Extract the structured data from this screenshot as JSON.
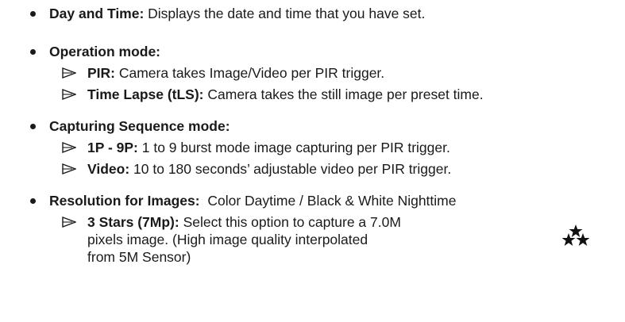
{
  "items": [
    {
      "label": "Day and Time:",
      "text": " Displays the date and time that you have set."
    },
    {
      "label": "Operation mode:",
      "subitems": [
        {
          "label": "PIR:",
          "text": " Camera takes Image/Video per PIR trigger."
        },
        {
          "label": "Time Lapse (tLS):",
          "text": " Camera takes the still image per preset time."
        }
      ]
    },
    {
      "label": "Capturing Sequence mode:",
      "subitems": [
        {
          "label": "1P - 9P:",
          "text": " 1 to 9 burst mode image capturing per PIR trigger."
        },
        {
          "label": "Video:",
          "text": " 10 to 180 seconds’ adjustable video per PIR trigger."
        }
      ]
    },
    {
      "label": "Resolution for Images:",
      "text": "  Color Daytime / Black & White Nighttime",
      "subitems": [
        {
          "label": "3 Stars (7Mp):",
          "text": " Select this option to capture a 7.0M",
          "continuation": [
            "pixels image. (High image quality interpolated",
            "from 5M Sensor)"
          ],
          "icon": "three-stars-icon"
        }
      ]
    }
  ]
}
